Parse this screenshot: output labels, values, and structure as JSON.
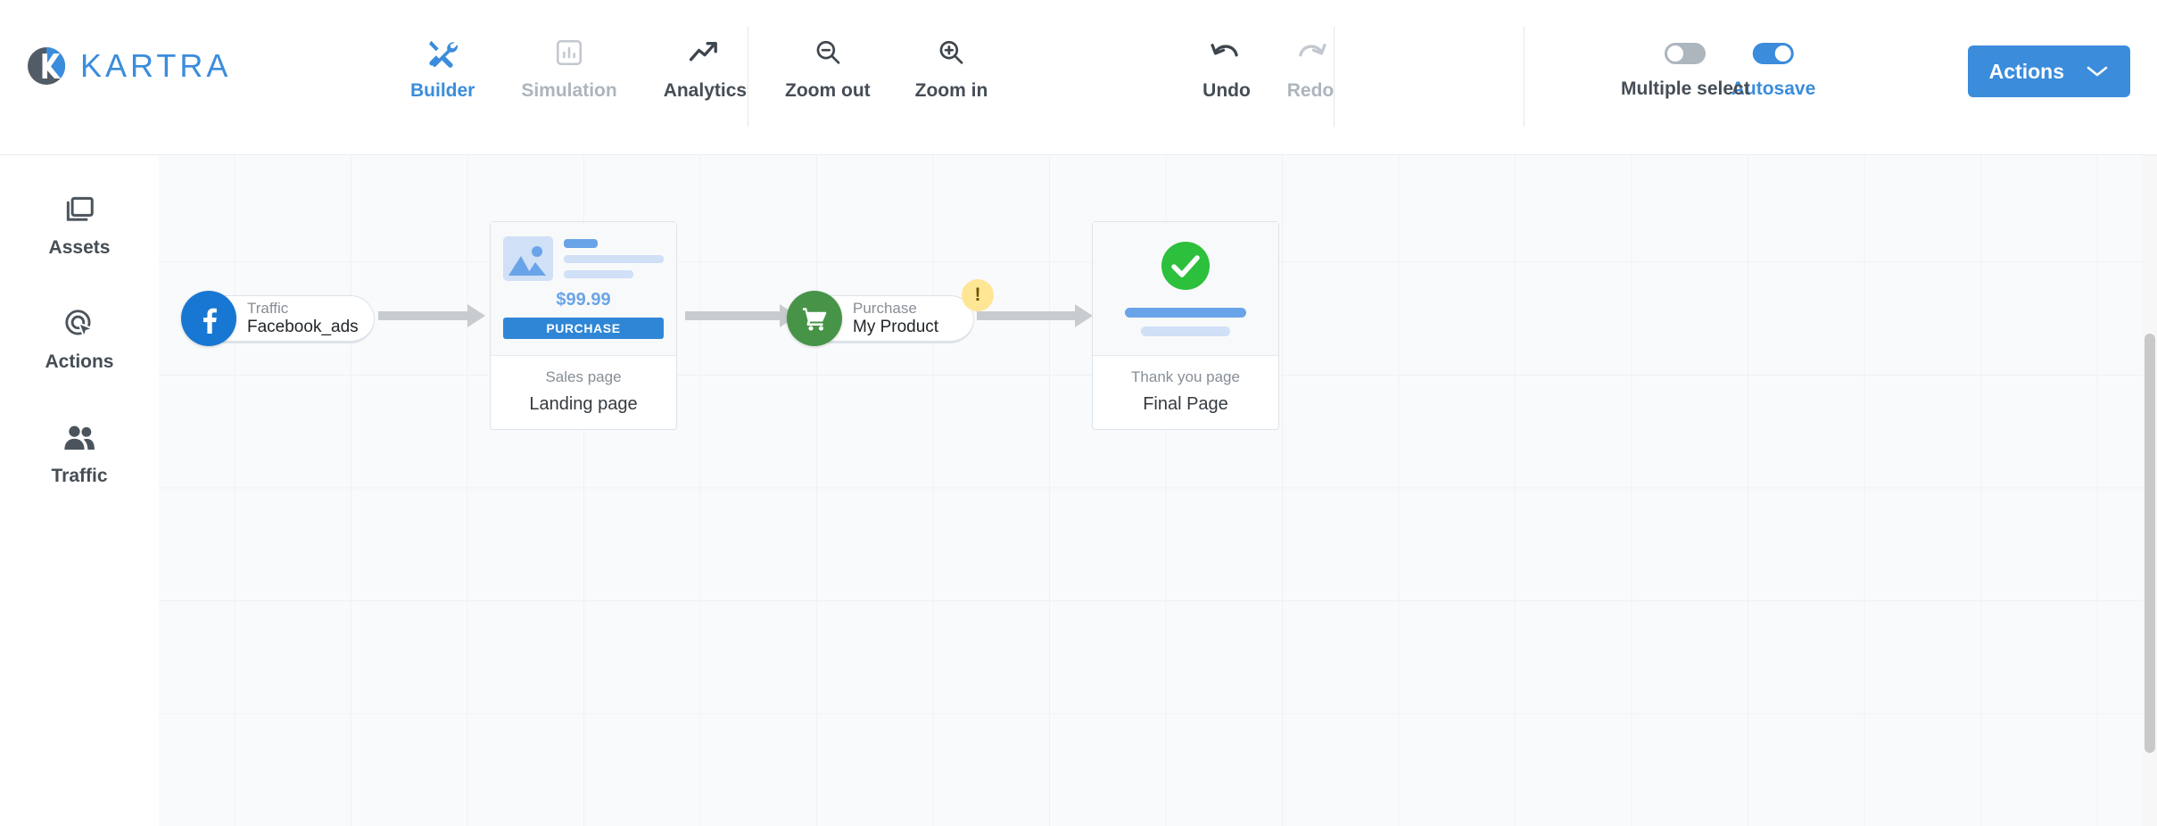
{
  "brand": {
    "name": "KARTRA",
    "logo_icon": "kartra-k-logo",
    "color": "#3b8cdb"
  },
  "header": {
    "modes": [
      {
        "label": "Builder",
        "icon": "tools-icon",
        "state": "active"
      },
      {
        "label": "Simulation",
        "icon": "bar-chart-box-icon",
        "state": "disabled"
      },
      {
        "label": "Analytics",
        "icon": "trend-up-arrow-icon",
        "state": "normal"
      }
    ],
    "zoom_controls": [
      {
        "label": "Zoom out",
        "icon": "magnifier-minus-icon"
      },
      {
        "label": "Zoom in",
        "icon": "magnifier-plus-icon"
      }
    ],
    "history": [
      {
        "label": "Undo",
        "icon": "undo-arrow-icon",
        "state": "normal"
      },
      {
        "label": "Redo",
        "icon": "redo-arrow-icon",
        "state": "disabled"
      }
    ],
    "toggles": [
      {
        "label": "Autosave",
        "state": "on",
        "label_color": "#3b8cdb"
      },
      {
        "label": "Multiple select",
        "state": "off",
        "label_color": "#454d55"
      }
    ],
    "actions_button": {
      "label": "Actions",
      "icon": "chevron-down-icon",
      "color": "#3b8cdb"
    }
  },
  "sidebar": {
    "items": [
      {
        "label": "Assets",
        "icon": "layers-window-icon"
      },
      {
        "label": "Actions",
        "icon": "target-cursor-icon"
      },
      {
        "label": "Traffic",
        "icon": "people-icon"
      }
    ]
  },
  "canvas": {
    "nodes": [
      {
        "id": "traffic-facebook",
        "type": "pill",
        "kicker": "Traffic",
        "title": "Facebook_ads",
        "icon": "facebook-f-icon",
        "badge_color": "#1877d2"
      },
      {
        "id": "sales-page",
        "type": "card",
        "kicker": "Sales page",
        "title": "Landing page",
        "price": "$99.99",
        "cta_label": "PURCHASE",
        "preview_icon": "image-placeholder-icon"
      },
      {
        "id": "purchase-product",
        "type": "pill",
        "kicker": "Purchase",
        "title": "My Product",
        "icon": "shopping-cart-icon",
        "badge_color": "#479448",
        "warning": {
          "symbol": "!",
          "color": "#ffe695"
        }
      },
      {
        "id": "thank-you-page",
        "type": "card",
        "kicker": "Thank you page",
        "title": "Final Page",
        "preview_icon": "green-check-circle-icon"
      }
    ]
  }
}
